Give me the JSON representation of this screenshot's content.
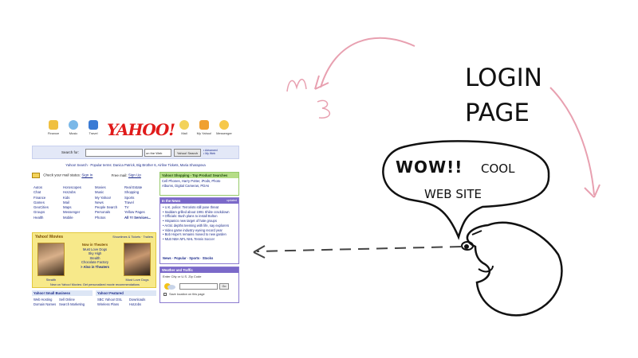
{
  "sketch": {
    "title_lines": [
      "LOGIN",
      "PAGE"
    ],
    "speech": {
      "wow": "WOW!!",
      "cool": "COOL",
      "website": "WEB SITE"
    },
    "colors": {
      "ink": "#111111",
      "pink": "#e8a0b0"
    }
  },
  "yahoo": {
    "nav_icons": [
      {
        "label": "Finance",
        "icon": "finance-icon"
      },
      {
        "label": "Music",
        "icon": "music-icon"
      },
      {
        "label": "Travel",
        "icon": "travel-icon"
      },
      {
        "label": "Mail",
        "icon": "mail-icon"
      },
      {
        "label": "My Yahoo!",
        "icon": "my-yahoo-icon"
      },
      {
        "label": "Messenger",
        "icon": "messenger-icon"
      }
    ],
    "logo": "YAHOO!",
    "search": {
      "label": "Search for:",
      "scope": "on the Web",
      "button": "Yahoo! Search",
      "advanced": "• Advanced",
      "my_web": "• My Web"
    },
    "popular": "Yahoo! Search · Popular terms: Danica Patrick, Big Brother 6, Airline Tickets, Maria Sharapova",
    "mail": {
      "check": "Check your mail status:",
      "sign_in": "Sign In",
      "free": "Free mail:",
      "sign_up": "Sign Up"
    },
    "directory": [
      [
        "Autos",
        "Chat",
        "Finance",
        "Games",
        "GeoCities",
        "Groups",
        "Health"
      ],
      [
        "Horoscopes",
        "HotJobs",
        "Kids",
        "Mail",
        "Maps",
        "Messenger",
        "Mobile"
      ],
      [
        "Movies",
        "Music",
        "My Yahoo!",
        "News",
        "People Search",
        "Personals",
        "Photos"
      ],
      [
        "Real Estate",
        "Shopping",
        "Sports",
        "Travel",
        "TV",
        "Yellow Pages",
        "All Y! Services..."
      ]
    ],
    "shopping": {
      "header": "Yahoo! Shopping - Top Product Searches",
      "text": "Cell Phones, Harry Potter, iPods, Photo Albums, Digital Cameras, PDAs"
    },
    "news": {
      "header": "In the News",
      "updated": "updated",
      "items": [
        "• U.K. police: Terrorists still pose threat",
        "• Saddam grilled about 1991 Shiite crackdown",
        "• Officials: Bush plans to install Bolton",
        "• Hispanics new target of hate groups",
        "• Arctic depths teeming with life, say explorers",
        "• Video game industry eyeing record year",
        "• Bob Hope's remains moved to new garden",
        "• MLB   NBA   NFL   NHL   Tennis   Soccer"
      ],
      "footer": "News · Popular · Sports · Stocks"
    },
    "movies": {
      "header": "Yahoo! Movies",
      "links": "Showtimes & Tickets · Trailers",
      "now_title": "Now in Theaters",
      "now_list": [
        "Must Love Dogs",
        "Sky High",
        "Stealth",
        "Chocolate Factory",
        "> Also in Theaters"
      ],
      "left_caption": "Stealth",
      "right_caption": "Must Love Dogs",
      "footer": "New on Yahoo! Movies: Get personalized movie recommendations"
    },
    "weather": {
      "header": "Weather and Traffic",
      "label": "Enter City or U.S. Zip Code",
      "go": "Go",
      "save": "Save location on this page"
    },
    "small_business": {
      "header": "Yahoo! Small Business",
      "items": [
        "Web Hosting",
        "Sell Online",
        "Domain Names",
        "Search Marketing"
      ]
    },
    "featured": {
      "header": "Yahoo! Featured",
      "items": [
        "SBC Yahoo! DSL",
        "Downloads",
        "Wireless Plans",
        "HotJobs"
      ]
    }
  }
}
